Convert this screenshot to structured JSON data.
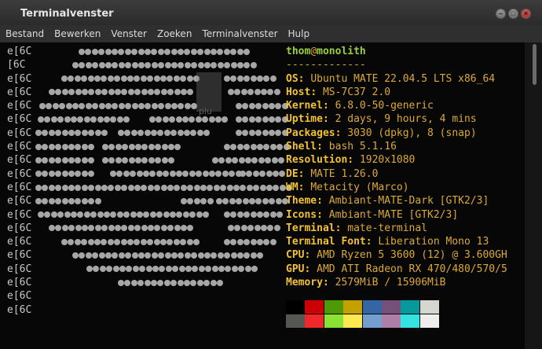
{
  "window": {
    "title": "Terminalvenster"
  },
  "menubar": [
    "Bestand",
    "Bewerken",
    "Venster",
    "Zoeken",
    "Terminalvenster",
    "Hulp"
  ],
  "terminal": {
    "left_lines": [
      "e[6C",
      "[6C",
      "e[6C",
      "e[6C",
      "e[6C",
      "e[6C",
      "e[6C",
      "e[6C",
      "e[6C",
      "e[6C",
      "e[6C",
      "e[6C",
      "e[6C",
      "e[6C",
      "e[6C",
      "e[6C",
      "e[6C",
      "e[6C",
      "e[6C",
      "e[6C"
    ],
    "ghost_label": "plu",
    "header": {
      "user": "thom",
      "at": "@",
      "host": "monolith",
      "separator": "-------------"
    },
    "info": [
      {
        "key": "OS",
        "value": "Ubuntu MATE 22.04.5 LTS x86_64"
      },
      {
        "key": "Host",
        "value": "MS-7C37 2.0"
      },
      {
        "key": "Kernel",
        "value": "6.8.0-50-generic"
      },
      {
        "key": "Uptime",
        "value": "2 days, 9 hours, 4 mins"
      },
      {
        "key": "Packages",
        "value": "3030 (dpkg), 8 (snap)"
      },
      {
        "key": "Shell",
        "value": "bash 5.1.16"
      },
      {
        "key": "Resolution",
        "value": "1920x1080"
      },
      {
        "key": "DE",
        "value": "MATE 1.26.0"
      },
      {
        "key": "WM",
        "value": "Metacity (Marco)"
      },
      {
        "key": "Theme",
        "value": "Ambiant-MATE-Dark [GTK2/3]"
      },
      {
        "key": "Icons",
        "value": "Ambiant-MATE [GTK2/3]"
      },
      {
        "key": "Terminal",
        "value": "mate-terminal"
      },
      {
        "key": "Terminal Font",
        "value": "Liberation Mono 13"
      },
      {
        "key": "CPU",
        "value": "AMD Ryzen 5 3600 (12) @ 3.600GH"
      },
      {
        "key": "GPU",
        "value": "AMD ATI Radeon RX 470/480/570/5"
      },
      {
        "key": "Memory",
        "value": "2579MiB / 15906MiB"
      }
    ],
    "palette_top": [
      "#000000",
      "#cc0000",
      "#4e9a06",
      "#c4a000",
      "#3465a4",
      "#75507b",
      "#06989a",
      "#d3d7cf"
    ],
    "palette_bottom": [
      "#555753",
      "#ef2929",
      "#8ae234",
      "#fce94f",
      "#729fcf",
      "#ad7fa8",
      "#34e2e2",
      "#eeeeec"
    ]
  }
}
